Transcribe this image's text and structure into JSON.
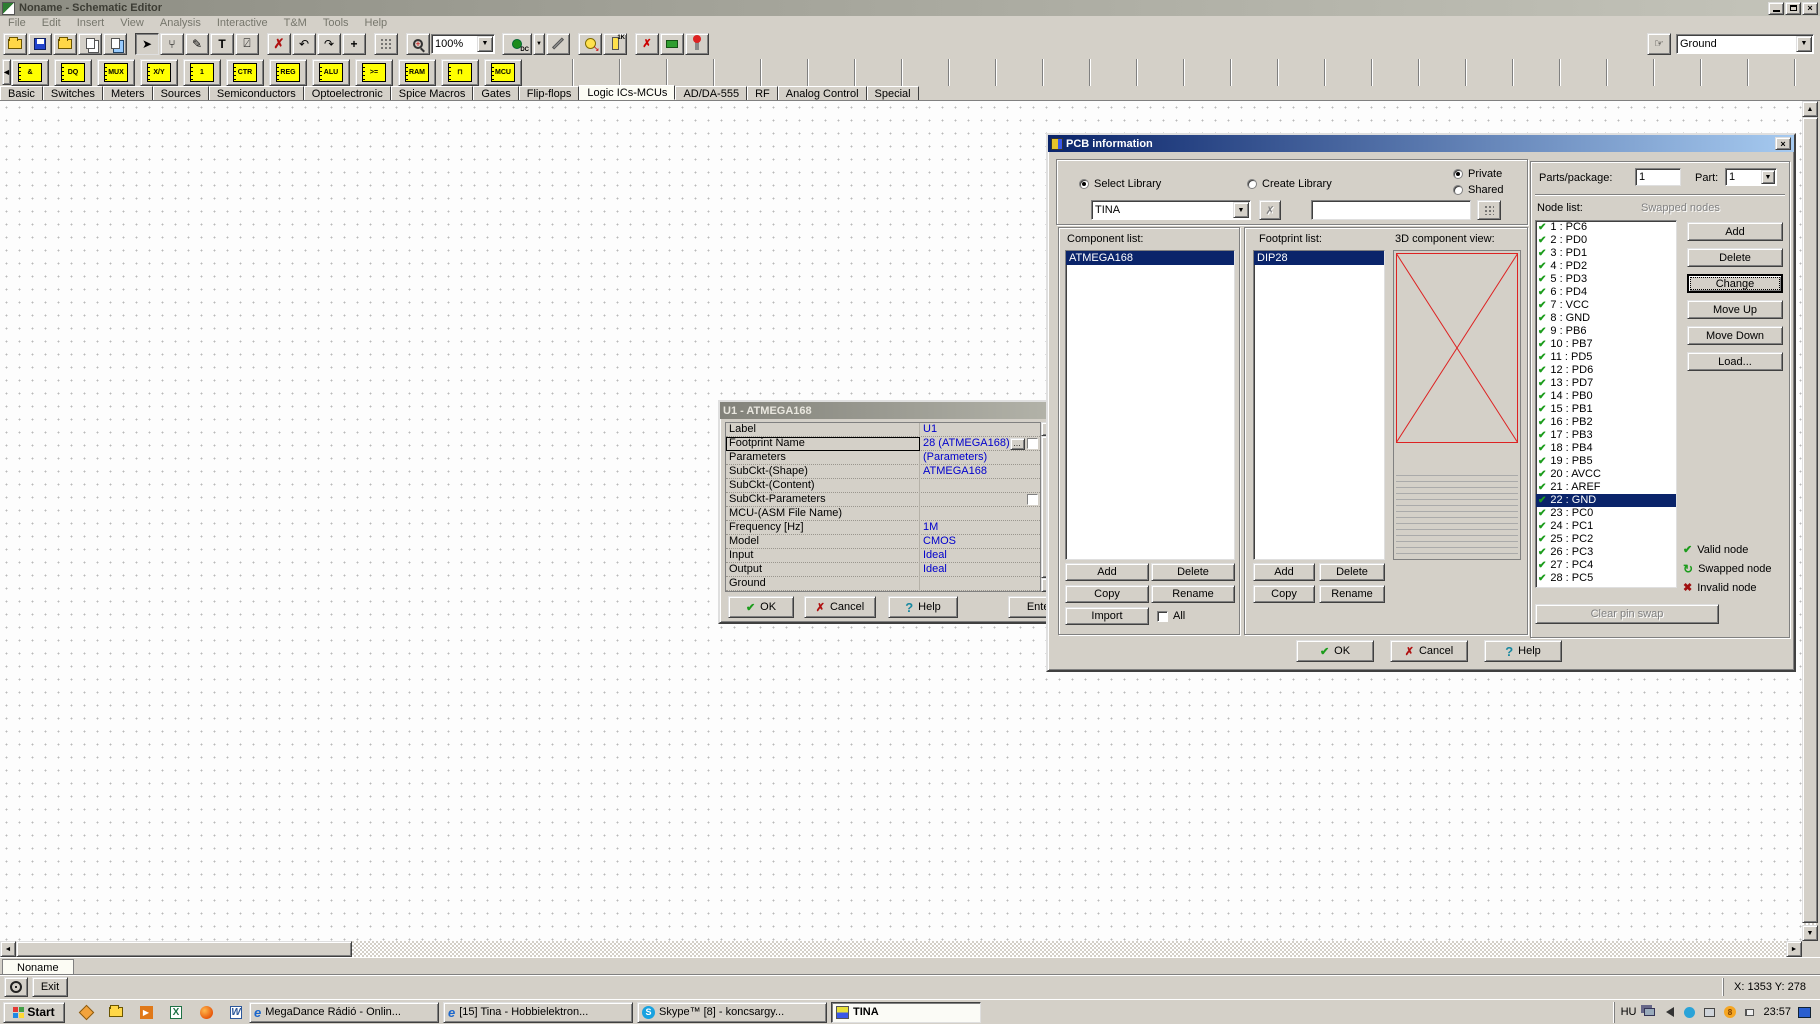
{
  "window": {
    "title": "Noname - Schematic Editor"
  },
  "menu": {
    "items": [
      "File",
      "Edit",
      "Insert",
      "View",
      "Analysis",
      "Interactive",
      "T&M",
      "Tools",
      "Help"
    ]
  },
  "toolbar": {
    "zoom": "100%",
    "dc": "DC",
    "battery": "1K",
    "ground": "Ground"
  },
  "parts_bar": {
    "items": [
      "&",
      "DQ",
      "MUX",
      "X/Y",
      "1",
      "CTR",
      "REG",
      "ALU",
      ">=",
      "RAM",
      "⊓",
      "MCU"
    ]
  },
  "tabs": {
    "items": [
      "Basic",
      "Switches",
      "Meters",
      "Sources",
      "Semiconductors",
      "Optoelectronic",
      "Spice Macros",
      "Gates",
      "Flip-flops",
      "Logic ICs-MCUs",
      "AD/DA-555",
      "RF",
      "Analog Control",
      "Special"
    ],
    "active_index": 9
  },
  "u1_dialog": {
    "title": "U1 - ATMEGA168",
    "focused_row": 1,
    "rows": [
      {
        "label": "Label",
        "value": "U1"
      },
      {
        "label": "Footprint Name",
        "value": "28 (ATMEGA168)",
        "btn": true,
        "chk": true
      },
      {
        "label": "Parameters",
        "value": "(Parameters)"
      },
      {
        "label": "SubCkt-(Shape)",
        "value": "ATMEGA168"
      },
      {
        "label": "SubCkt-(Content)",
        "value": ""
      },
      {
        "label": "SubCkt-Parameters",
        "value": "",
        "chk": true
      },
      {
        "label": "MCU-(ASM File Name)",
        "value": ""
      },
      {
        "label": "Frequency [Hz]",
        "value": "1M"
      },
      {
        "label": "Model",
        "value": "CMOS"
      },
      {
        "label": "Input",
        "value": "Ideal"
      },
      {
        "label": "Output",
        "value": "Ideal"
      },
      {
        "label": "Ground",
        "value": ""
      }
    ],
    "ok": "OK",
    "cancel": "Cancel",
    "help": "Help",
    "enter": "Enter"
  },
  "pcb": {
    "title": "PCB information",
    "select_library": "Select Library",
    "create_library": "Create Library",
    "private": "Private",
    "shared": "Shared",
    "library": "TINA",
    "filter": "",
    "component_list_label": "Component list:",
    "components": [
      "ATMEGA168"
    ],
    "component_selected": 0,
    "component_buttons": [
      "Add",
      "Delete",
      "Copy",
      "Rename",
      "Import"
    ],
    "all_label": "All",
    "footprint_list_label": "Footprint list:",
    "footprints": [
      "DIP28"
    ],
    "footprint_selected": 0,
    "footprint_buttons": [
      "Add",
      "Delete",
      "Copy",
      "Rename"
    ],
    "view3d_label": "3D component view:",
    "parts_package_label": "Parts/package:",
    "parts_package": "1",
    "part_label": "Part:",
    "part": "1",
    "node_list_label": "Node list:",
    "swapped_nodes_label": "Swapped nodes",
    "nodes": [
      "1 : PC6",
      "2 : PD0",
      "3 : PD1",
      "4 : PD2",
      "5 : PD3",
      "6 : PD4",
      "7 : VCC",
      "8 : GND",
      "9 : PB6",
      "10 : PB7",
      "11 : PD5",
      "12 : PD6",
      "13 : PD7",
      "14 : PB0",
      "15 : PB1",
      "16 : PB2",
      "17 : PB3",
      "18 : PB4",
      "19 : PB5",
      "20 : AVCC",
      "21 : AREF",
      "22 : GND",
      "23 : PC0",
      "24 : PC1",
      "25 : PC2",
      "26 : PC3",
      "27 : PC4",
      "28 : PC5"
    ],
    "node_selected": 21,
    "node_buttons": [
      "Add",
      "Delete",
      "Change",
      "Move Up",
      "Move Down",
      "Load..."
    ],
    "node_button_focused": 2,
    "legend": [
      {
        "label": "Valid node"
      },
      {
        "label": "Swapped node"
      },
      {
        "label": "Invalid node"
      }
    ],
    "clear_pin_swap": "Clear pin swap",
    "ok": "OK",
    "cancel": "Cancel",
    "help": "Help"
  },
  "bottom": {
    "doc_tab": "Noname",
    "exit": "Exit",
    "coords": "X: 1353  Y: 278"
  },
  "taskbar": {
    "start": "Start",
    "tasks": [
      {
        "label": "MegaDance Rádió - Onlin..."
      },
      {
        "label": "[15] Tina - Hobbielektron..."
      },
      {
        "label": "Skype™ [8] - koncsargy..."
      },
      {
        "label": "TINA"
      }
    ],
    "language": "HU",
    "time": "23:57"
  }
}
